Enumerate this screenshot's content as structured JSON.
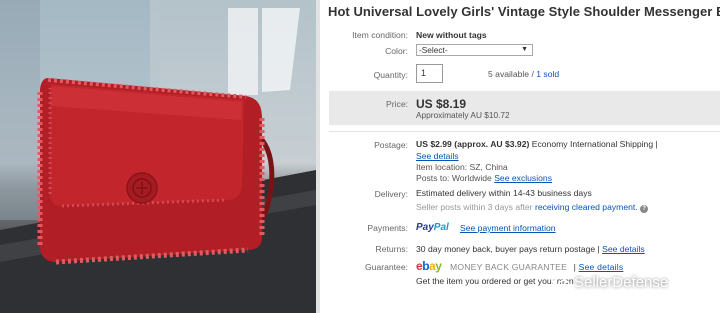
{
  "listing": {
    "title": "Hot Universal Lovely Girls' Vintage Style Shoulder Messenger Bag Party S",
    "condition": {
      "label": "Item condition:",
      "value": "New without tags"
    },
    "color": {
      "label": "Color:",
      "selected": "-Select-"
    },
    "quantity": {
      "label": "Quantity:",
      "value": "1",
      "available": "5 available / ",
      "sold": "1 sold"
    },
    "price": {
      "label": "Price:",
      "amount": "US $8.19",
      "approx": "Approximately AU $10.72"
    },
    "postage": {
      "label": "Postage:",
      "cost": "US $2.99 (approx. AU $3.92)",
      "method": "Economy International Shipping |",
      "details_link": "See details",
      "location": "Item location: SZ, China",
      "posts_to": "Posts to: Worldwide",
      "exclusions_link": "See exclusions"
    },
    "delivery": {
      "label": "Delivery:",
      "estimate": "Estimated delivery within 14-43 business days",
      "note": "Seller posts within 3 days after",
      "cleared_link": "receiving cleared payment",
      "period": "."
    },
    "payments": {
      "label": "Payments:",
      "paypal_a": "Pay",
      "paypal_b": "Pal",
      "info_link": "See payment information"
    },
    "returns": {
      "label": "Returns:",
      "text": "30 day money back, buyer pays return postage |",
      "details_link": "See details"
    },
    "guarantee": {
      "label": "Guarantee:",
      "ebay": [
        "e",
        "b",
        "a",
        "y"
      ],
      "mbg": "MONEY BACK GUARANTEE",
      "sep": "|",
      "details_link": "See details",
      "line": "Get the item you ordered or get your mon"
    }
  },
  "watermark": {
    "text": "SellerDefense"
  },
  "colors": {
    "link": "#0654ba",
    "price_bg": "#e9e9e9",
    "bag": "#b21e25"
  }
}
